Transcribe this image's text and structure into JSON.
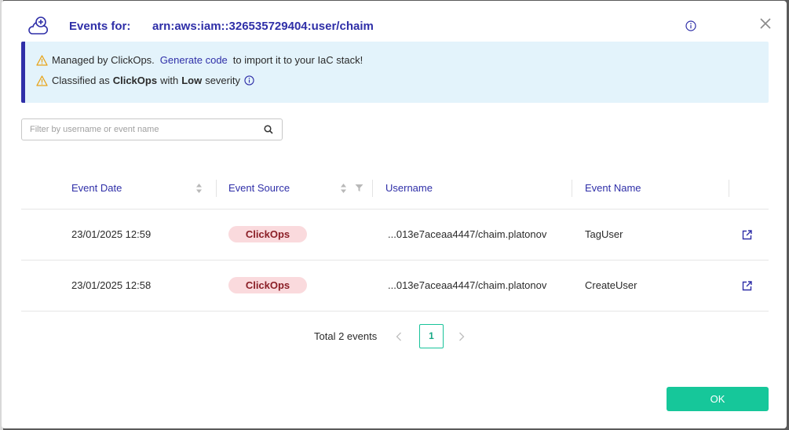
{
  "header": {
    "title_label": "Events for:",
    "title_arn": "arn:aws:iam::326535729404:user/chaim",
    "cloud_icon": "cloud-plus-icon",
    "info_icon": "info-icon",
    "close_icon": "close-icon"
  },
  "banner": {
    "line1_prefix": "Managed by ClickOps.",
    "line1_link": "Generate code",
    "line1_suffix": "to import it to your IaC stack!",
    "line2_prefix": "Classified as",
    "line2_class": "ClickOps",
    "line2_mid": "with",
    "line2_severity": "Low",
    "line2_suffix": "severity",
    "accent_color": "#2f2fa8",
    "background_color": "#e3f3fb",
    "warning_color": "#e8a317"
  },
  "search": {
    "placeholder": "Filter by username or event name",
    "value": ""
  },
  "table": {
    "columns": [
      "Event Date",
      "Event Source",
      "Username",
      "Event Name"
    ],
    "rows": [
      {
        "date": "23/01/2025 12:59",
        "source": "ClickOps",
        "username": "...013e7aceaa4447/chaim.platonov",
        "event_name": "TagUser"
      },
      {
        "date": "23/01/2025 12:58",
        "source": "ClickOps",
        "username": "...013e7aceaa4447/chaim.platonov",
        "event_name": "CreateUser"
      }
    ]
  },
  "pagination": {
    "total_label": "Total 2 events",
    "current_page": "1"
  },
  "footer": {
    "ok_label": "OK",
    "ok_color": "#16c79a"
  }
}
